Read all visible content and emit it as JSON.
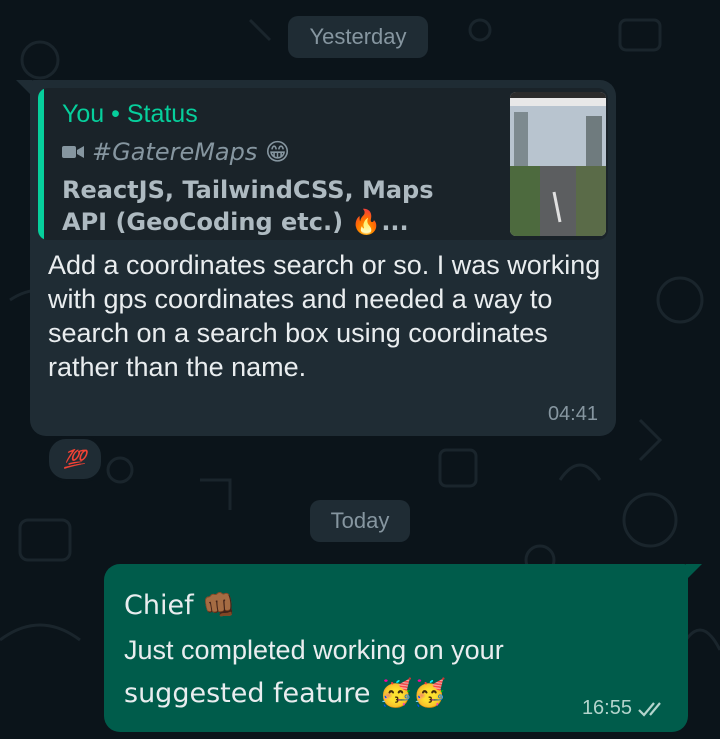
{
  "dates": {
    "yesterday": "Yesterday",
    "today": "Today"
  },
  "incoming": {
    "quote": {
      "author": "You • Status",
      "media_label": "#GatereMaps 😁",
      "text": "ReactJS, TailwindCSS, Maps API (GeoCoding etc.) 🔥...",
      "media_icon": "video-icon"
    },
    "text": "Add a coordinates search or so. I was working with gps coordinates and needed a way to search on a search box using coordinates rather than the name.",
    "time": "04:41",
    "reaction": "💯"
  },
  "outgoing": {
    "line1": "Chief 👊🏾",
    "line2": "Just completed working on your",
    "line3": "suggested feature 🥳🥳",
    "time": "16:55",
    "status_icon": "double-check-icon"
  },
  "colors": {
    "background": "#0b141a",
    "incoming_bubble": "#1f2c34",
    "outgoing_bubble": "#005c4b",
    "accent": "#06cf9c"
  }
}
